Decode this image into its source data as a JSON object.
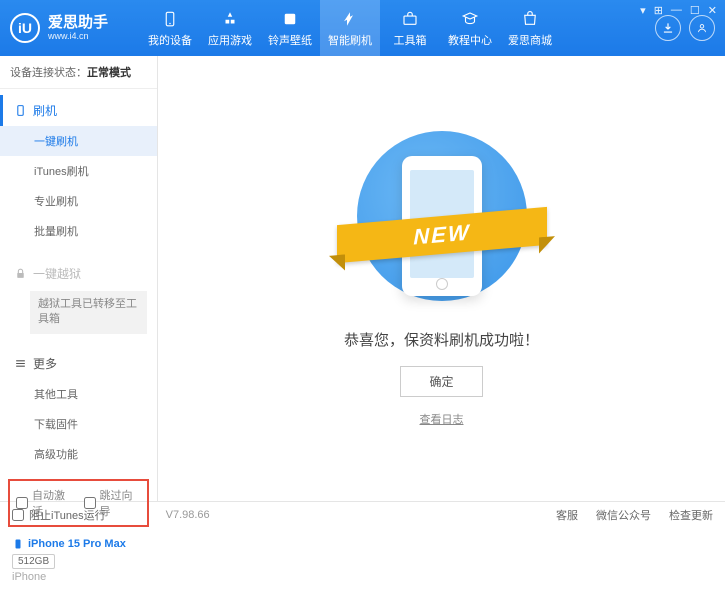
{
  "app": {
    "name": "爱思助手",
    "url": "www.i4.cn",
    "logo_letter": "iU"
  },
  "nav": [
    {
      "label": "我的设备",
      "icon": "device"
    },
    {
      "label": "应用游戏",
      "icon": "apps"
    },
    {
      "label": "铃声壁纸",
      "icon": "ringtone"
    },
    {
      "label": "智能刷机",
      "icon": "flash"
    },
    {
      "label": "工具箱",
      "icon": "toolbox"
    },
    {
      "label": "教程中心",
      "icon": "tutorial"
    },
    {
      "label": "爱思商城",
      "icon": "store"
    }
  ],
  "status": {
    "label": "设备连接状态：",
    "value": "正常模式"
  },
  "sidebar": {
    "flash": {
      "header": "刷机",
      "items": [
        "一键刷机",
        "iTunes刷机",
        "专业刷机",
        "批量刷机"
      ]
    },
    "jailbreak": {
      "header": "一键越狱",
      "note": "越狱工具已转移至工具箱"
    },
    "more": {
      "header": "更多",
      "items": [
        "其他工具",
        "下载固件",
        "高级功能"
      ]
    }
  },
  "checkboxes": {
    "auto_activate": "自动激活",
    "skip_setup": "跳过向导"
  },
  "device": {
    "name": "iPhone 15 Pro Max",
    "storage": "512GB",
    "type": "iPhone"
  },
  "main": {
    "ribbon": "NEW",
    "success": "恭喜您，保资料刷机成功啦！",
    "confirm": "确定",
    "log_link": "查看日志"
  },
  "footer": {
    "block_itunes": "阻止iTunes运行",
    "version": "V7.98.66",
    "links": [
      "客服",
      "微信公众号",
      "检查更新"
    ]
  }
}
